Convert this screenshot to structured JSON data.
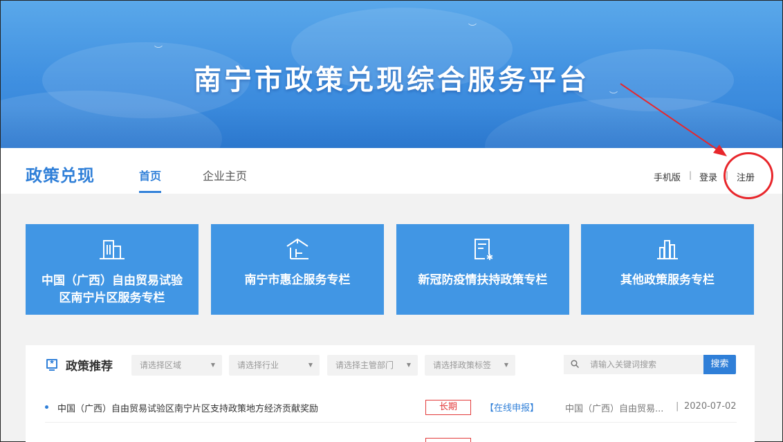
{
  "banner": {
    "title": "南宁市政策兑现综合服务平台"
  },
  "nav": {
    "logo": "政策兑现",
    "tabs": [
      {
        "label": "首页",
        "active": true
      },
      {
        "label": "企业主页",
        "active": false
      }
    ],
    "links": {
      "mobile": "手机版",
      "sep1": "|",
      "login": "登录",
      "sep2": "|",
      "register": "注册"
    }
  },
  "tiles": [
    {
      "icon": "building-icon",
      "label": "中国（广西）自由贸易试验区南宁片区服务专栏"
    },
    {
      "icon": "enterprise-icon",
      "label": "南宁市惠企服务专栏"
    },
    {
      "icon": "epidemic-doc-icon",
      "label": "新冠防疫情扶持政策专栏"
    },
    {
      "icon": "city-icon",
      "label": "其他政策服务专栏"
    }
  ],
  "policy": {
    "title": "政策推荐",
    "filters": [
      "请选择区域",
      "请选择行业",
      "请选择主管部门",
      "请选择政策标签"
    ],
    "search_placeholder": "请输入关键词搜索",
    "search_button": "搜索",
    "rows": [
      {
        "title": "中国（广西）自由贸易试验区南宁片区支持政策地方经济贡献奖励",
        "tag": "长期",
        "action": "【在线申报】",
        "dept": "中国（广西）自由贸易...",
        "sep": "|",
        "date": "2020-07-02"
      }
    ]
  },
  "colors": {
    "primary": "#2f7fd8",
    "tile": "#4196e4",
    "annotation": "#e8262b"
  }
}
